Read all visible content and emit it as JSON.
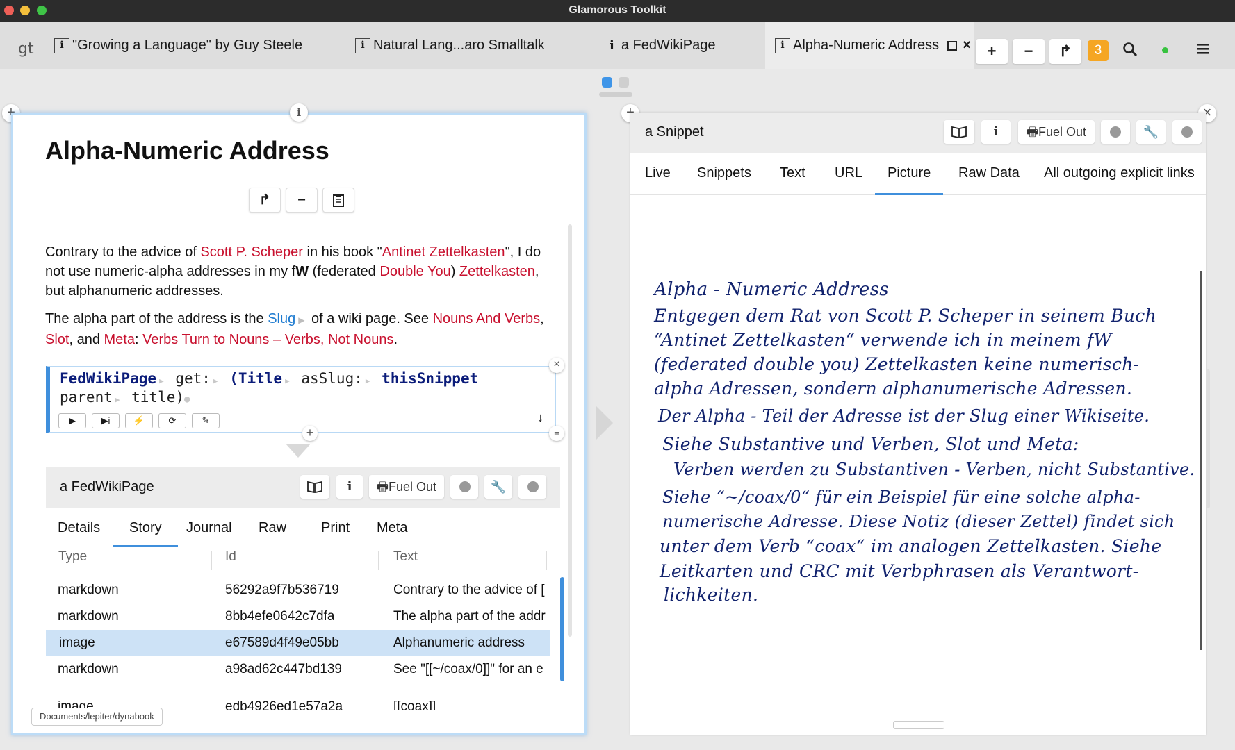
{
  "window": {
    "title": "Glamorous Toolkit",
    "traffic_lights": {
      "close": "#ee5f57",
      "minimize": "#f4bf3c",
      "maximize": "#3fc447"
    }
  },
  "tabbar": {
    "logo": "gt",
    "tabs": [
      {
        "label": "\"Growing a Language\" by Guy Steele",
        "icon": "info-box-icon"
      },
      {
        "label": "Natural Lang...aro Smalltalk",
        "icon": "info-box-icon"
      },
      {
        "label": "a FedWikiPage",
        "icon": "info-icon"
      },
      {
        "label": "Alpha-Numeric Address",
        "icon": "info-box-icon",
        "active": true
      }
    ],
    "badge_count": "3",
    "badge_color": "#f5a623",
    "status_dot_color": "#37c23f"
  },
  "left_pane": {
    "title": "Alpha-Numeric Address",
    "para1": {
      "t1": "Contrary to the advice of ",
      "l1": "Scott P. Scheper",
      "t2": " in his book \"",
      "l2": "Antinet Zettelkasten",
      "t3": "\", I do not use numeric-alpha addresses in my f",
      "w": "W",
      "t4": " (federated ",
      "l3": "Double You",
      "t5": ") ",
      "l4": "Zettelkasten",
      "t6": ", but alphanumeric addresses."
    },
    "para2": {
      "t1": "The alpha part of the address is the ",
      "l1": "Slug",
      "t2": " of a wiki page. See ",
      "l2": "Nouns And Verbs",
      "t3": ",",
      "l3": "Slot",
      "t4": ", and ",
      "l4": "Meta",
      "t5": ": ",
      "l5": "Verbs Turn to Nouns",
      "t6": " – ",
      "l6": "Verbs, Not Nouns",
      "t7": "."
    },
    "code": {
      "t_class": "FedWikiPage",
      "t_get": "get:",
      "t_open": "(Title",
      "t_asslug": "asSlug:",
      "t_this": "thisSnippet",
      "t_parent": "parent",
      "t_title": "title)"
    },
    "inspector": {
      "title": "a FedWikiPage",
      "fuel_out": "Fuel Out",
      "tabs": [
        "Details",
        "Story",
        "Journal",
        "Raw",
        "Print",
        "Meta"
      ],
      "active_tab": "Story",
      "columns": [
        "Type",
        "Id",
        "Text"
      ],
      "rows": [
        {
          "type": "markdown",
          "id": "56292a9f7b536719",
          "text": "Contrary to the advice of ["
        },
        {
          "type": "markdown",
          "id": "8bb4efe0642c7dfa",
          "text": "The alpha part of the addr"
        },
        {
          "type": "image",
          "id": "e67589d4f49e05bb",
          "text": "Alphanumeric address"
        },
        {
          "type": "markdown",
          "id": "a98ad62c447bd139",
          "text": "See \"[[~/coax/0]]\" for an e"
        },
        {
          "type": "image",
          "id": "edb4926ed1e57a2a",
          "text": "[[coax]]"
        }
      ]
    },
    "path": "Documents/lepiter/dynabook"
  },
  "right_pane": {
    "title": "a Snippet",
    "fuel_out": "Fuel Out",
    "tabs": [
      "Live",
      "Snippets",
      "Text",
      "URL",
      "Picture",
      "Raw Data",
      "All outgoing explicit links"
    ],
    "active_tab": "Picture",
    "handwriting": [
      "Alpha - Numeric Address",
      "Entgegen dem Rat von Scott P. Scheper in seinem Buch",
      "“Antinet Zettelkasten“ verwende ich in meinem fW",
      "(federated double you) Zettelkasten keine numerisch-",
      "alpha Adressen, sondern alphanumerische Adressen.",
      "Der Alpha - Teil der Adresse ist der Slug einer Wikiseite.",
      "Siehe Substantive und Verben, Slot und Meta:",
      "Verben werden zu Substantiven - Verben, nicht Substantive.",
      "Siehe “~/coax/0“ für ein Beispiel für eine solche alpha-",
      "numerische Adresse. Diese Notiz (dieser Zettel) findet sich",
      "unter dem Verb “coax“ im analogen Zettelkasten. Siehe",
      "Leitkarten und CRC mit Verbphrasen als Verantwort-",
      "lichkeiten."
    ]
  }
}
